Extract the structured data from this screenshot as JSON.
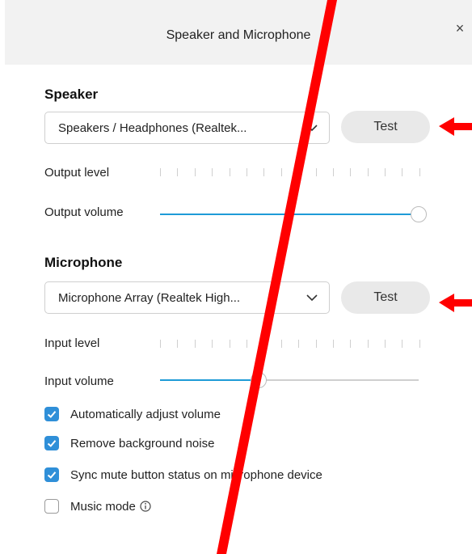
{
  "window": {
    "title": "Speaker and Microphone",
    "close_glyph": "×"
  },
  "speaker": {
    "section_title": "Speaker",
    "device": "Speakers / Headphones (Realtek...",
    "test_label": "Test",
    "output_level_label": "Output level",
    "output_volume_label": "Output volume",
    "output_volume_value": 1.0
  },
  "microphone": {
    "section_title": "Microphone",
    "device": "Microphone Array (Realtek High...",
    "test_label": "Test",
    "input_level_label": "Input level",
    "input_volume_label": "Input volume",
    "input_volume_value": 0.38
  },
  "options": [
    {
      "label": "Automatically adjust volume",
      "checked": true
    },
    {
      "label": "Remove background noise",
      "checked": true
    },
    {
      "label": "Sync mute button status on microphone device",
      "checked": true
    },
    {
      "label": "Music mode",
      "checked": false,
      "icon": "info-icon"
    }
  ],
  "colors": {
    "accent": "#2f8fd8",
    "slider_fill": "#1e9bd7",
    "annotation": "#ff0000"
  },
  "icons": [
    "close-icon",
    "chevron-down-icon",
    "check-icon",
    "info-icon",
    "arrow-left-icon"
  ]
}
